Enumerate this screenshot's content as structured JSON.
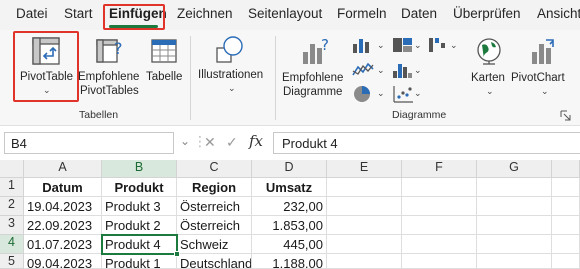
{
  "menu": {
    "tabs": [
      "Datei",
      "Start",
      "Einfügen",
      "Zeichnen",
      "Seitenlayout",
      "Formeln",
      "Daten",
      "Überprüfen",
      "Ansicht"
    ],
    "active_tab": "Einfügen"
  },
  "ribbon": {
    "tabellen_group": {
      "label": "Tabellen",
      "pivottable_label": "PivotTable",
      "recommended_pivottables_line1": "Empfohlene",
      "recommended_pivottables_line2": "PivotTables",
      "table_label": "Tabelle"
    },
    "illustrations_label": "Illustrationen",
    "diagramme_group": {
      "label": "Diagramme",
      "recommended_charts_line1": "Empfohlene",
      "recommended_charts_line2": "Diagramme",
      "maps_label": "Karten",
      "pivotchart_label": "PivotChart"
    }
  },
  "formula_bar": {
    "name_box": "B4",
    "fx_label": "fx",
    "cancel_symbol": "✕",
    "confirm_symbol": "✓",
    "content": "Produkt 4"
  },
  "sheet": {
    "columns": [
      "A",
      "B",
      "C",
      "D",
      "E",
      "F",
      "G"
    ],
    "rows": [
      "1",
      "2",
      "3",
      "4",
      "5"
    ],
    "headers": [
      "Datum",
      "Produkt",
      "Region",
      "Umsatz"
    ],
    "data": [
      [
        "19.04.2023",
        "Produkt 3",
        "Österreich",
        "232,00"
      ],
      [
        "22.09.2023",
        "Produkt 2",
        "Österreich",
        "1.853,00"
      ],
      [
        "01.07.2023",
        "Produkt 4",
        "Schweiz",
        "445,00"
      ],
      [
        "09.04.2023",
        "Produkt 1",
        "Deutschland",
        "1.188,00"
      ]
    ],
    "active_cell": "B4"
  },
  "colors": {
    "accent_green": "#1d7a3e",
    "highlight_red": "#e0332a"
  }
}
